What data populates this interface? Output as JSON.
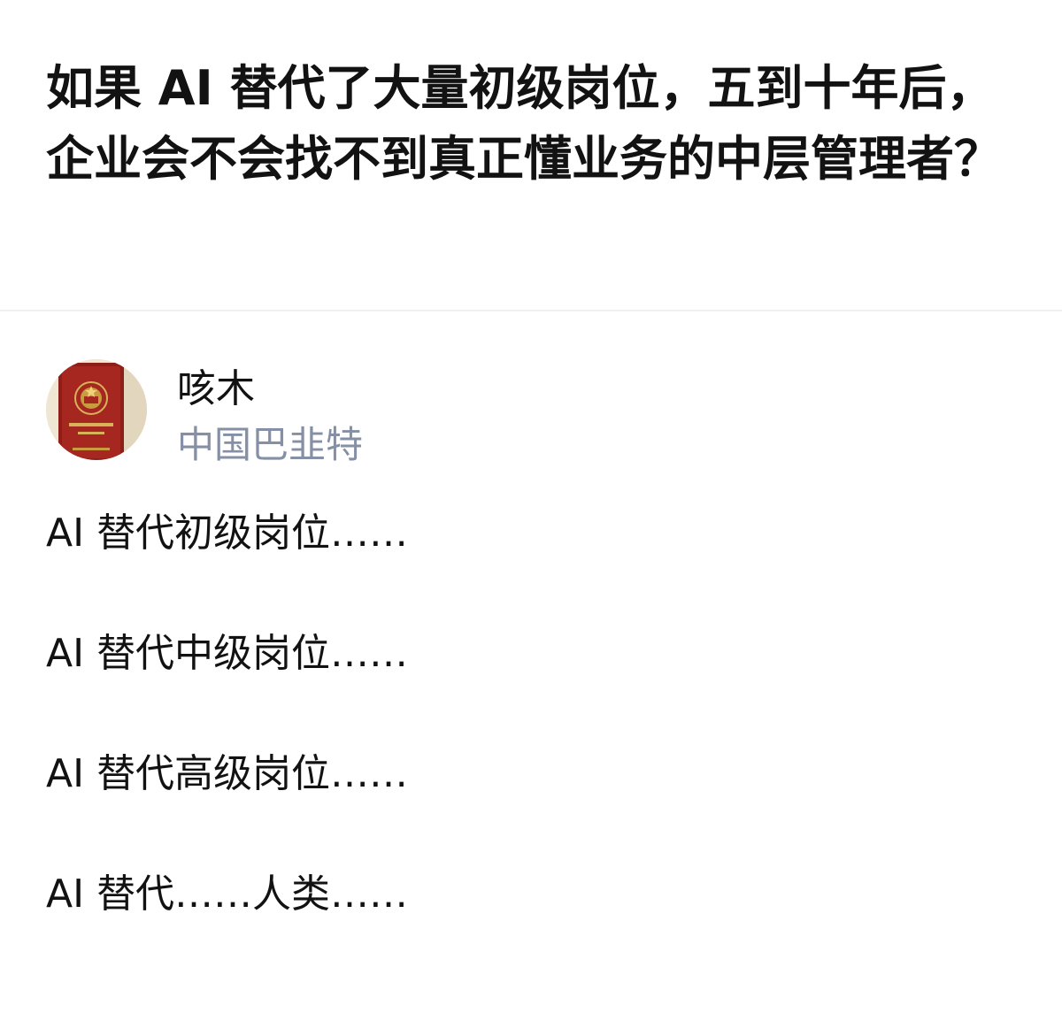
{
  "question": {
    "title": "如果 AI 替代了大量初级岗位，五到十年后，企业会不会找不到真正懂业务的中层管理者？"
  },
  "answer": {
    "author": {
      "name": "咳木",
      "bio": "中国巴韭特",
      "avatar_icon": "red-certificate-booklet-avatar"
    },
    "paragraphs": [
      "AI 替代初级岗位……",
      "AI 替代中级岗位……",
      "AI 替代高级岗位……",
      "AI 替代……人类……"
    ]
  },
  "colors": {
    "title": "#121212",
    "body": "#121212",
    "bio": "#8590a6",
    "divider": "#f0f0f2"
  }
}
